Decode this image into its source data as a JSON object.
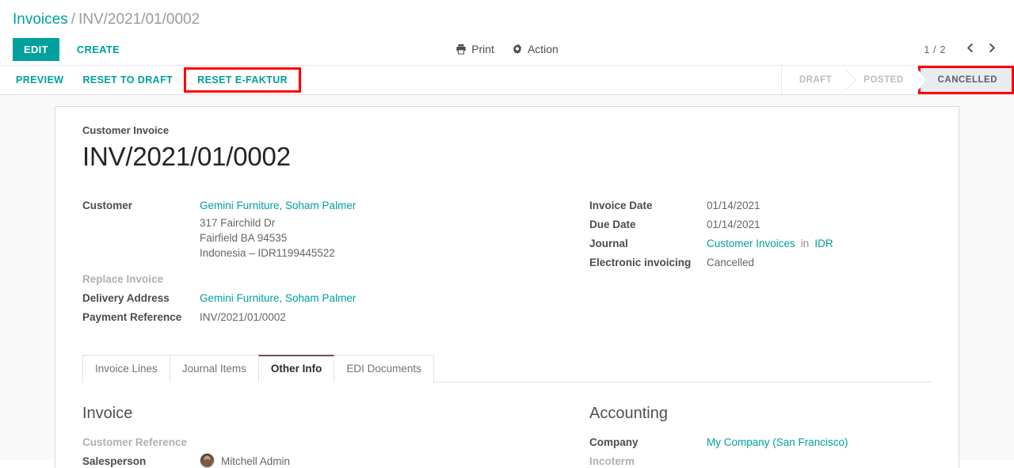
{
  "breadcrumb": {
    "root": "Invoices",
    "separator": "/",
    "current": "INV/2021/01/0002"
  },
  "control_panel": {
    "edit_label": "EDIT",
    "create_label": "CREATE",
    "print_label": "Print",
    "action_label": "Action",
    "print_icon": "printer-icon",
    "action_icon": "gear-icon",
    "pager_value": "1 / 2",
    "prev_icon": "chevron-left-icon",
    "next_icon": "chevron-right-icon"
  },
  "button_bar": {
    "buttons": [
      {
        "label": "PREVIEW",
        "highlighted": false
      },
      {
        "label": "RESET TO DRAFT",
        "highlighted": false
      },
      {
        "label": "RESET E-FAKTUR",
        "highlighted": true
      }
    ],
    "highlight_color": "#ff0000"
  },
  "statusbar": {
    "stages": [
      {
        "label": "DRAFT",
        "active": false,
        "highlighted": false
      },
      {
        "label": "POSTED",
        "active": false,
        "highlighted": false
      },
      {
        "label": "CANCELLED",
        "active": true,
        "highlighted": true
      }
    ]
  },
  "form": {
    "title_label": "Customer Invoice",
    "title": "INV/2021/01/0002",
    "left": {
      "customer_label": "Customer",
      "customer_value": "Gemini Furniture, Soham Palmer",
      "customer_address": [
        "317 Fairchild Dr",
        "Fairfield BA 94535",
        "Indonesia – IDR1199445522"
      ],
      "replace_invoice_label": "Replace Invoice",
      "replace_invoice_value": "",
      "delivery_address_label": "Delivery Address",
      "delivery_address_value": "Gemini Furniture, Soham Palmer",
      "payment_reference_label": "Payment Reference",
      "payment_reference_value": "INV/2021/01/0002"
    },
    "right": {
      "invoice_date_label": "Invoice Date",
      "invoice_date_value": "01/14/2021",
      "due_date_label": "Due Date",
      "due_date_value": "01/14/2021",
      "journal_label": "Journal",
      "journal_value": "Customer Invoices",
      "journal_sep": "in",
      "journal_currency": "IDR",
      "electronic_invoicing_label": "Electronic invoicing",
      "electronic_invoicing_value": "Cancelled"
    }
  },
  "notebook": {
    "tabs": [
      {
        "label": "Invoice Lines",
        "active": false
      },
      {
        "label": "Journal Items",
        "active": false
      },
      {
        "label": "Other Info",
        "active": true
      },
      {
        "label": "EDI Documents",
        "active": false
      }
    ],
    "active_tab_accent": "#714B67"
  },
  "other_info": {
    "invoice": {
      "group_title": "Invoice",
      "customer_reference_label": "Customer Reference",
      "customer_reference_value": "",
      "salesperson_label": "Salesperson",
      "salesperson_value": "Mitchell Admin",
      "salesperson_avatar": "user-avatar"
    },
    "accounting": {
      "group_title": "Accounting",
      "company_label": "Company",
      "company_value": "My Company (San Francisco)",
      "incoterm_label": "Incoterm",
      "incoterm_value": ""
    }
  },
  "theme": {
    "accent": "#00A09D",
    "tab_accent": "#714B67",
    "highlight": "#ff0000"
  }
}
